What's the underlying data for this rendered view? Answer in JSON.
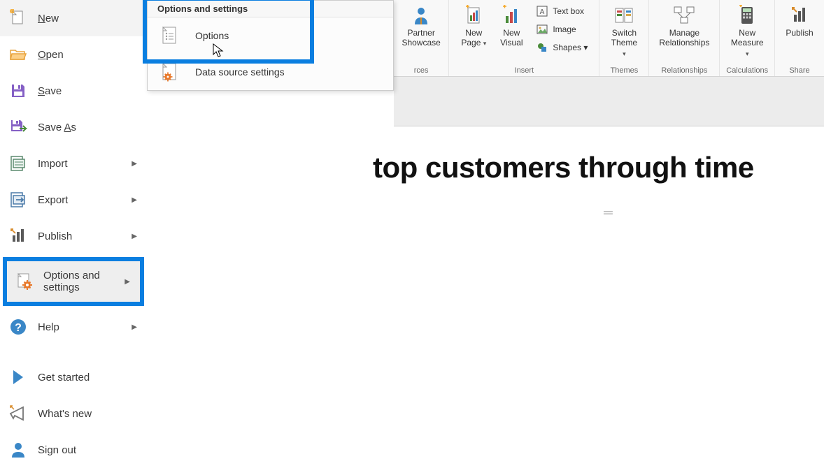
{
  "file_menu": {
    "new": "New",
    "open": "Open",
    "save": "Save",
    "save_as": "Save As",
    "import": "Import",
    "export": "Export",
    "publish": "Publish",
    "options_settings": "Options and settings",
    "help": "Help",
    "get_started": "Get started",
    "whats_new": "What's new",
    "sign_out": "Sign out"
  },
  "submenu": {
    "header": "Options and settings",
    "options": "Options",
    "data_source": "Data source settings"
  },
  "ribbon": {
    "partner_showcase": "Partner Showcase",
    "new_page": "New Page",
    "new_visual": "New Visual",
    "text_box": "Text box",
    "image": "Image",
    "shapes": "Shapes",
    "shapes_caret": "▾",
    "switch_theme": "Switch Theme",
    "manage_relationships": "Manage Relationships",
    "new_measure": "New Measure",
    "publish": "Publish",
    "groups": {
      "resources": "rces",
      "insert": "Insert",
      "themes": "Themes",
      "relationships": "Relationships",
      "calculations": "Calculations",
      "share": "Share"
    }
  },
  "canvas": {
    "title": "top customers through time"
  }
}
